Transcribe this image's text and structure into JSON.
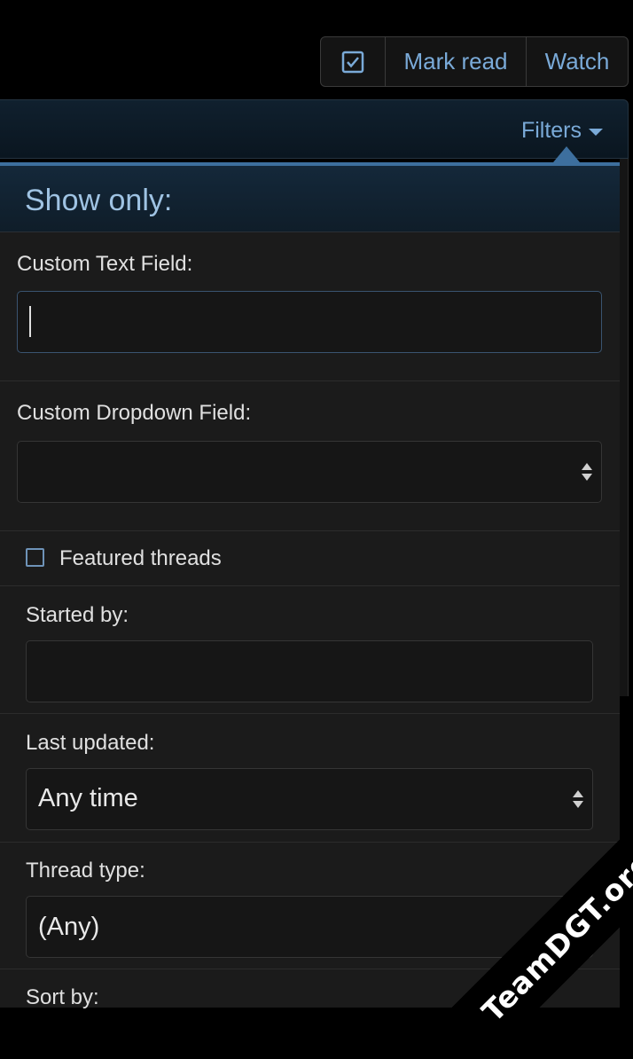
{
  "toolbar": {
    "check_icon": "checkbox-icon",
    "mark_read_label": "Mark read",
    "watch_label": "Watch"
  },
  "filter_bar": {
    "filters_label": "Filters",
    "caret_icon": "caret-down-icon"
  },
  "menu": {
    "title": "Show only:",
    "custom_text_field": {
      "label": "Custom Text Field:",
      "value": ""
    },
    "custom_dropdown_field": {
      "label": "Custom Dropdown Field:",
      "value": ""
    },
    "featured_threads": {
      "label": "Featured threads",
      "checked": false
    },
    "started_by": {
      "label": "Started by:",
      "value": ""
    },
    "last_updated": {
      "label": "Last updated:",
      "value": "Any time"
    },
    "thread_type": {
      "label": "Thread type:",
      "value": "(Any)"
    },
    "sort_by": {
      "label": "Sort by:"
    }
  },
  "watermark": "TeamDGT.org",
  "colors": {
    "accent": "#7aaad8",
    "menu_border": "#3d6f9e",
    "background": "#000000",
    "panel": "#1b1b1b"
  }
}
